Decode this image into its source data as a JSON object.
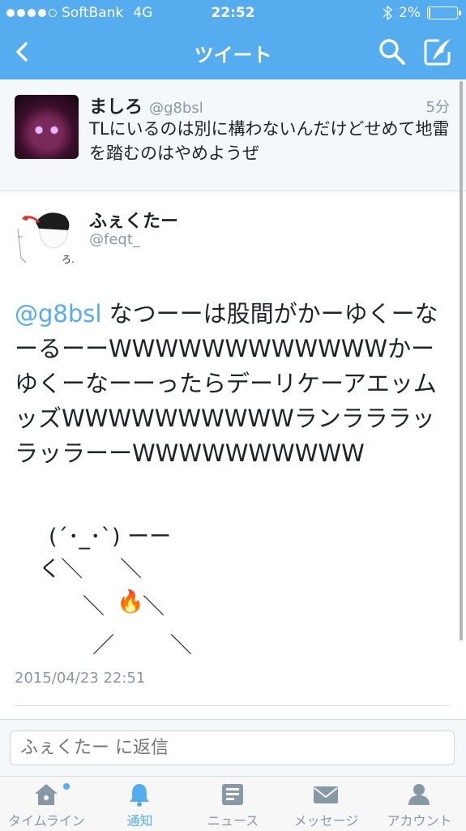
{
  "status_bar": {
    "carrier": "SoftBank",
    "network": "4G",
    "time": "22:52",
    "battery": "2%"
  },
  "nav": {
    "title": "ツイート"
  },
  "reply_context": {
    "display_name": "ましろ",
    "handle": "@g8bsl",
    "time_ago": "5分",
    "text": "TLにいるのは別に構わないんだけどせめて地雷を踏むのはやめようぜ"
  },
  "tweet": {
    "display_name": "ふぇくたー",
    "handle": "@feqt_",
    "mention": "@g8bsl",
    "text": "  なつーーは股間がかーゆくーなーるーーWWWWWWWWWWWWかーゆくーなーーったらデーリケーアエッムッズWWWWWWWWWWランラララッラッラーーWWWWWWWWWW",
    "ascii_art": {
      "line1": "(´･_･`) ーー",
      "line2a": "く＼",
      "line2b": "＼",
      "line3a": "＼",
      "line3b": "🔥",
      "line3c": "＼",
      "line4a": "／",
      "line4b": "＼"
    },
    "timestamp": "2015/04/23 22:51"
  },
  "reply_box": {
    "placeholder": "ふぇくたー に返信"
  },
  "tab_bar": {
    "items": [
      {
        "label": "タイムライン",
        "icon": "home-icon"
      },
      {
        "label": "通知",
        "icon": "bell-icon"
      },
      {
        "label": "ニュース",
        "icon": "news-icon"
      },
      {
        "label": "メッセージ",
        "icon": "envelope-icon"
      },
      {
        "label": "アカウント",
        "icon": "person-icon"
      }
    ],
    "active_index": 1
  },
  "colors": {
    "brand": "#55acee",
    "text": "#1f2327",
    "muted": "#8899a6"
  }
}
